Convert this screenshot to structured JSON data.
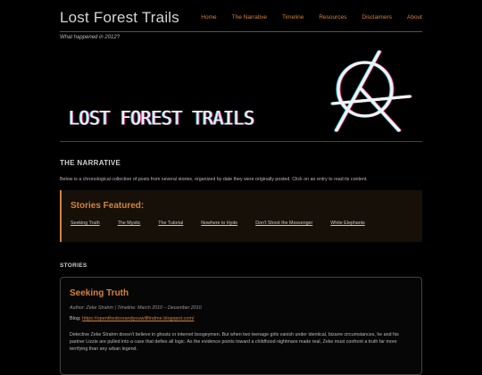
{
  "site": {
    "title": "Lost Forest Trails",
    "tagline": "What happened in 2012?"
  },
  "nav": [
    "Home",
    "The Narrative",
    "Timeline",
    "Resources",
    "Disclaimers",
    "About"
  ],
  "banner": {
    "text": "LOST FOREST TRAILS",
    "symbol": "anarchy-icon"
  },
  "narrative": {
    "heading": "THE NARRATIVE",
    "intro": "Below is a chronological collection of posts from several stories, organized by date they were originally posted. Click on an entry to read its content."
  },
  "featured": {
    "title": "Stories Featured:",
    "stories": [
      "Seeking Truth",
      "The Mystic",
      "The Tutorial",
      "Nowhere to Hyde",
      "Don't Shoot the Messenger",
      "White Elephants"
    ]
  },
  "stories_label": "STORIES",
  "story_card": {
    "title": "Seeking Truth",
    "meta": "Author: Zeke Strahm | Timeline: March 2010 – December 2010",
    "blog_label": "Blog: ",
    "blog_url": "https://openthedoorandyouwillfindme.blogspot.com/",
    "description": "Detective Zeke Strahm doesn't believe in ghosts or internet boogeymen. But when two teenage girls vanish under identical, bizarre circumstances, he and his partner Lizzie are pulled into a case that defies all logic. As the evidence points toward a childhood nightmare made real, Zeke must confront a truth far more terrifying than any urban legend."
  },
  "colors": {
    "accent": "#d4833d",
    "background": "#000000",
    "text": "#c9c9c9"
  }
}
